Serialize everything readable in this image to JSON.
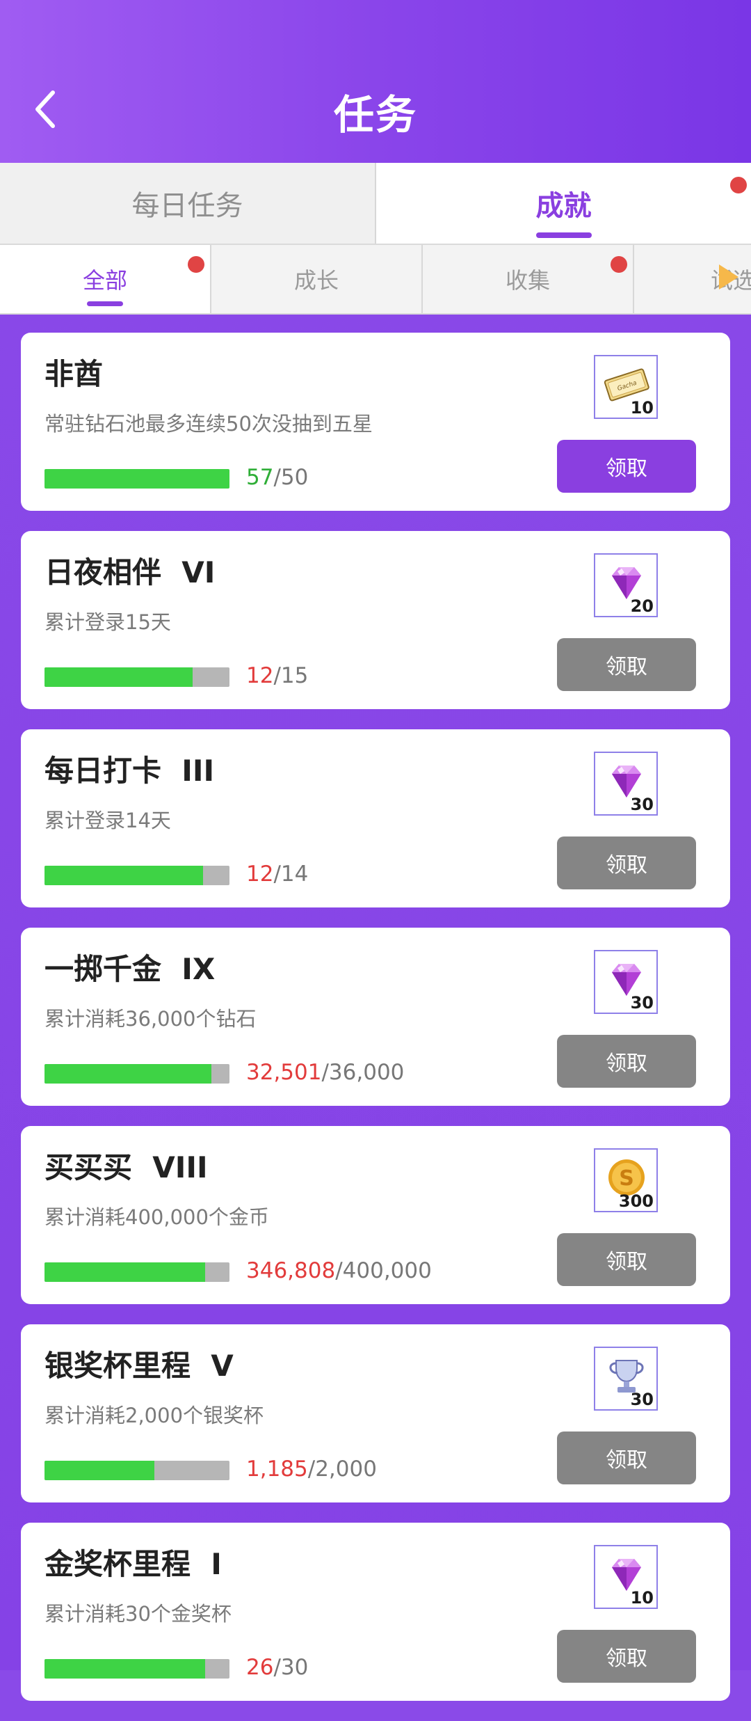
{
  "header": {
    "title": "任务"
  },
  "main_tabs": [
    {
      "label": "每日任务"
    },
    {
      "label": "成就"
    }
  ],
  "sub_tabs": [
    {
      "label": "全部"
    },
    {
      "label": "成长"
    },
    {
      "label": "收集"
    },
    {
      "label": "试选"
    }
  ],
  "achievements": [
    {
      "title": "非酋",
      "desc": "常驻钻石池最多连续50次没抽到五星",
      "current": "57",
      "total": "/50",
      "progress": 1.0,
      "reward_icon": "gacha-ticket-icon",
      "reward_count": "10",
      "claim_label": "领取",
      "claimable": true
    },
    {
      "title": "日夜相伴  VI",
      "desc": "累计登录15天",
      "current": "12",
      "total": "/15",
      "progress": 0.8,
      "reward_icon": "diamond-icon",
      "reward_count": "20",
      "claim_label": "领取",
      "claimable": false
    },
    {
      "title": "每日打卡  III",
      "desc": "累计登录14天",
      "current": "12",
      "total": "/14",
      "progress": 0.857,
      "reward_icon": "diamond-icon",
      "reward_count": "30",
      "claim_label": "领取",
      "claimable": false
    },
    {
      "title": "一掷千金  IX",
      "desc": "累计消耗36,000个钻石",
      "current": "32,501",
      "total": "/36,000",
      "progress": 0.903,
      "reward_icon": "diamond-icon",
      "reward_count": "30",
      "claim_label": "领取",
      "claimable": false
    },
    {
      "title": "买买买  VIII",
      "desc": "累计消耗400,000个金币",
      "current": "346,808",
      "total": "/400,000",
      "progress": 0.867,
      "reward_icon": "gold-coin-icon",
      "reward_count": "300",
      "claim_label": "领取",
      "claimable": false
    },
    {
      "title": "银奖杯里程  V",
      "desc": "累计消耗2,000个银奖杯",
      "current": "1,185",
      "total": "/2,000",
      "progress": 0.5925,
      "reward_icon": "silver-trophy-icon",
      "reward_count": "30",
      "claim_label": "领取",
      "claimable": false
    },
    {
      "title": "金奖杯里程  I",
      "desc": "累计消耗30个金奖杯",
      "current": "26",
      "total": "/30",
      "progress": 0.867,
      "reward_icon": "diamond-icon",
      "reward_count": "10",
      "claim_label": "领取",
      "claimable": false
    }
  ],
  "colors": {
    "accent": "#8a3fe0",
    "progress_fill": "#3ed345",
    "progress_track": "#b6b6b6",
    "incomplete_value": "#e23b3b",
    "complete_value": "#2fae37",
    "notification_dot": "#e04444"
  }
}
